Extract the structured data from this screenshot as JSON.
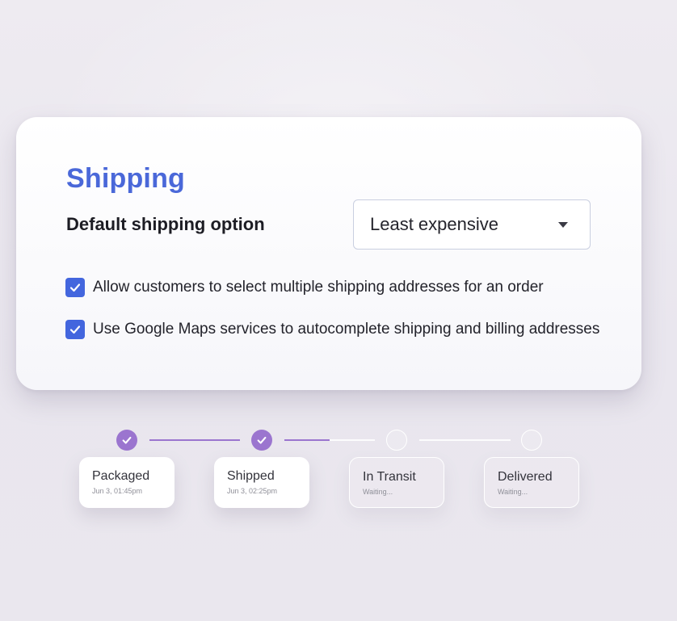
{
  "shipping": {
    "title": "Shipping",
    "default_option_label": "Default shipping option",
    "default_option_value": "Least expensive",
    "checkboxes": [
      {
        "label": "Allow customers to select multiple shipping addresses for an order",
        "checked": true
      },
      {
        "label": "Use Google Maps services to autocomplete shipping and billing addresses",
        "checked": true
      }
    ]
  },
  "tracking": {
    "steps": [
      {
        "name": "Packaged",
        "detail": "Jun 3, 01:45pm",
        "status": "done"
      },
      {
        "name": "Shipped",
        "detail": "Jun 3, 02:25pm",
        "status": "done"
      },
      {
        "name": "In Transit",
        "detail": "Waiting...",
        "status": "pending"
      },
      {
        "name": "Delivered",
        "detail": "Waiting...",
        "status": "pending"
      }
    ]
  },
  "colors": {
    "accent_blue": "#4a68d9",
    "checkbox_blue": "#4366de",
    "progress_purple": "#9b75cf"
  }
}
